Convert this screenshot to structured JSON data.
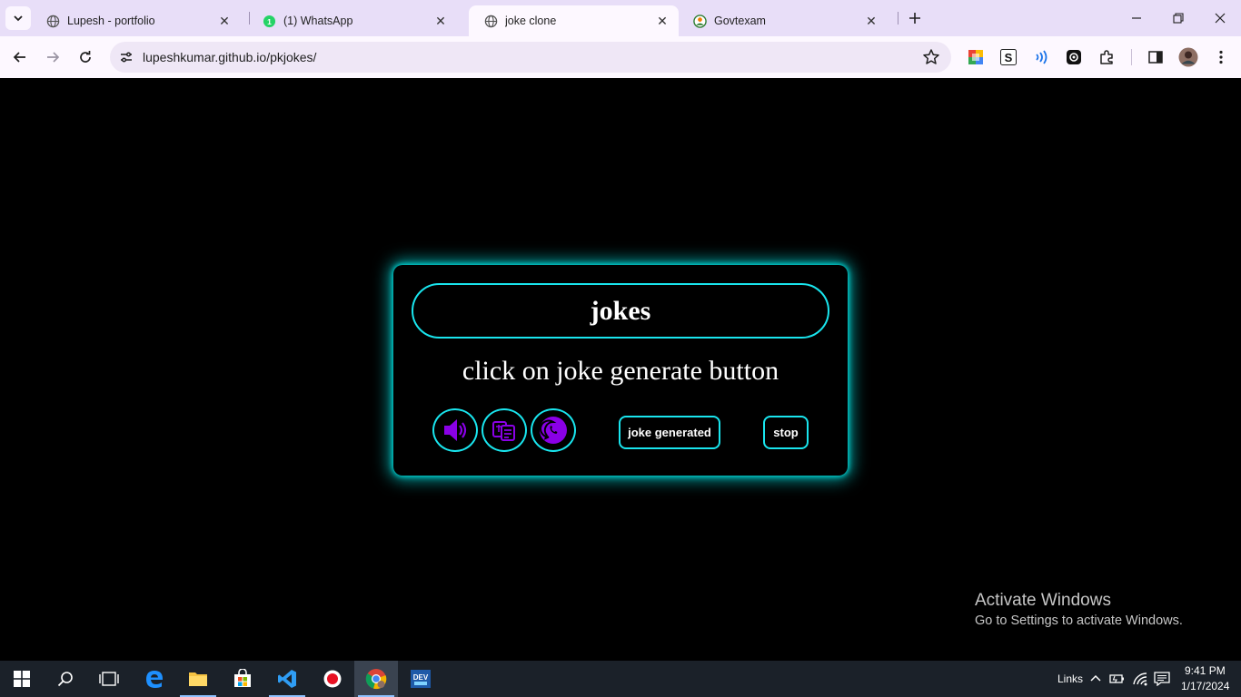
{
  "browser": {
    "tabs": [
      {
        "title": "Lupesh - portfolio",
        "favicon": "globe-icon",
        "active": false
      },
      {
        "title": "(1) WhatsApp",
        "favicon": "whatsapp-icon",
        "active": false
      },
      {
        "title": "joke clone",
        "favicon": "globe-icon",
        "active": true
      },
      {
        "title": "Govtexam",
        "favicon": "govtexam-icon",
        "active": false
      }
    ],
    "url": "lupeshkumar.github.io/pkjokes/"
  },
  "page": {
    "heading": "jokes",
    "joke_text": "click on joke generate button",
    "icon_buttons": [
      "speaker-icon",
      "translate-icon",
      "whatsapp-icon"
    ],
    "generate_label": "joke generated",
    "stop_label": "stop",
    "accent_color": "#19e5ee",
    "icon_color": "#8a00e6"
  },
  "watermark": {
    "title": "Activate Windows",
    "subtitle": "Go to Settings to activate Windows."
  },
  "taskbar": {
    "links_label": "Links",
    "time": "9:41 PM",
    "date": "1/17/2024"
  }
}
